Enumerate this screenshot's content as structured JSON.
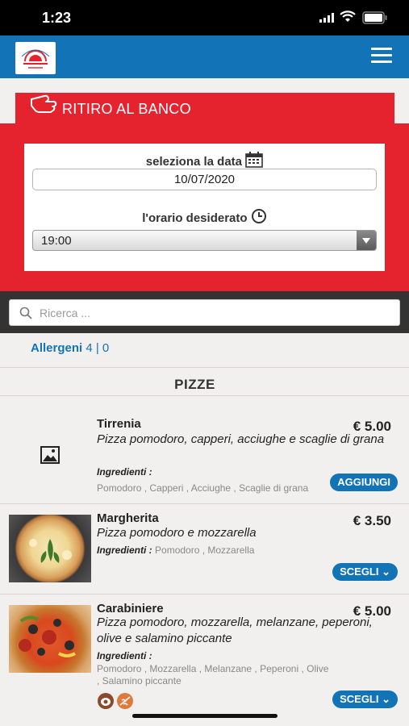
{
  "status": {
    "time": "1:23"
  },
  "header": {
    "logo_alt": "Logo",
    "menu_icon": "hamburger-icon"
  },
  "pickup": {
    "title": "RITIRO AL BANCO",
    "date_label": "seleziona la data",
    "date_value": "10/07/2020",
    "time_label": "l'orario desiderato",
    "time_value": "19:00"
  },
  "search": {
    "placeholder": "Ricerca ..."
  },
  "allergens": {
    "label": "Allergeni",
    "count": "4 | 0"
  },
  "section": {
    "title": "PIZZE"
  },
  "products": [
    {
      "name": "Tirrenia",
      "price": "€ 5.00",
      "description": "Pizza pomodoro, capperi, acciughe e scaglie di grana",
      "ingredients_label": "Ingredienti :",
      "ingredients": "Pomodoro , Capperi , Acciughe , Scaglie di grana",
      "button": "AGGIUNGI"
    },
    {
      "name": "Margherita",
      "price": "€ 3.50",
      "description": "Pizza pomodoro e mozzarella",
      "ingredients_label": "Ingredienti :",
      "ingredients": "Pomodoro , Mozzarella",
      "button": "SCEGLI ⌄"
    },
    {
      "name": "Carabiniere",
      "price": "€ 5.00",
      "description": "Pizza pomodoro, mozzarella, melanzane, peperoni, olive e salamino piccante",
      "ingredients_label": "Ingredienti :",
      "ingredients": "Pomodoro , Mozzarella , Melanzane , Peperoni , Olive , Salamino piccante",
      "button": "SCEGLI ⌄"
    }
  ],
  "colors": {
    "primary": "#1273b6",
    "accent": "#e4232f"
  }
}
